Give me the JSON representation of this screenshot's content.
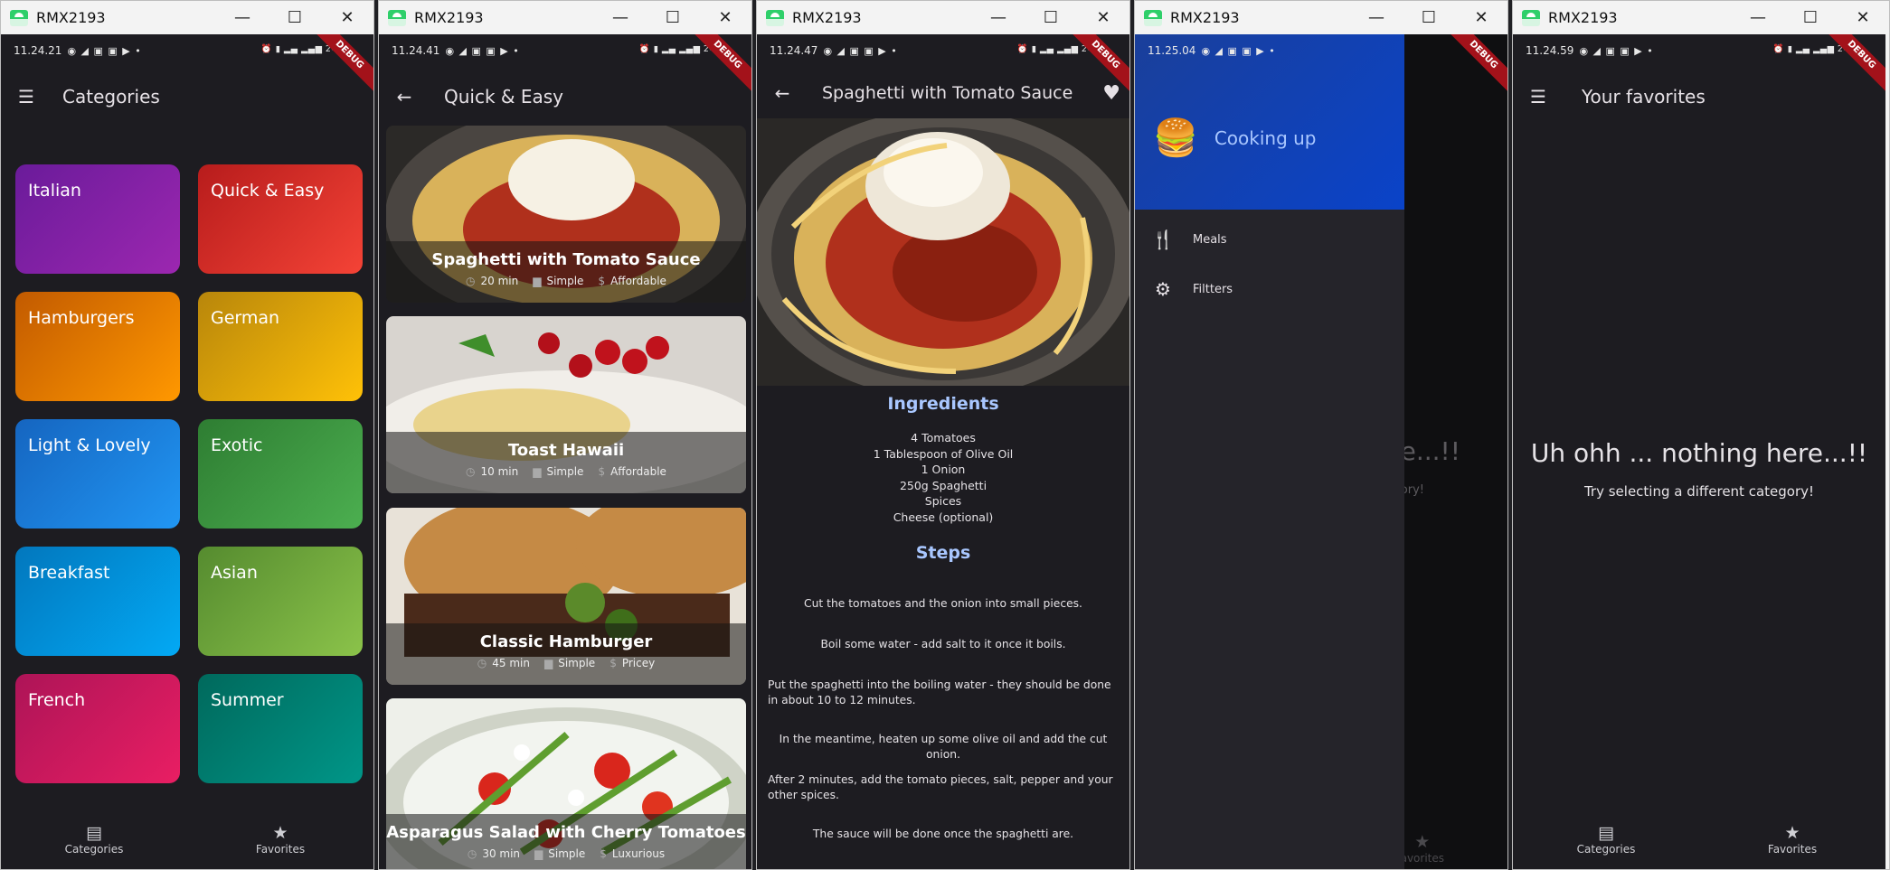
{
  "window_title": "RMX2193",
  "windows": [
    {
      "status_time": "11.24.21"
    },
    {
      "status_time": "11.24.41"
    },
    {
      "status_time": "11.24.47"
    },
    {
      "status_time": "11.25.04"
    },
    {
      "status_time": "11.24.59"
    }
  ],
  "debug_banner": "DEBUG",
  "categories_screen": {
    "title": "Categories",
    "categories": [
      {
        "label": "Italian",
        "color1": "#6a1b9a",
        "color2": "#9c27b0"
      },
      {
        "label": "Quick & Easy",
        "color1": "#b71c1c",
        "color2": "#f44336"
      },
      {
        "label": "Hamburgers",
        "color1": "#c25a00",
        "color2": "#ff9800"
      },
      {
        "label": "German",
        "color1": "#b8860b",
        "color2": "#ffc107"
      },
      {
        "label": "Light & Lovely",
        "color1": "#1565c0",
        "color2": "#2196f3"
      },
      {
        "label": "Exotic",
        "color1": "#2e7d32",
        "color2": "#4caf50"
      },
      {
        "label": "Breakfast",
        "color1": "#0277bd",
        "color2": "#03a9f4"
      },
      {
        "label": "Asian",
        "color1": "#558b2f",
        "color2": "#8bc34a"
      },
      {
        "label": "French",
        "color1": "#ad1457",
        "color2": "#e91e63"
      },
      {
        "label": "Summer",
        "color1": "#00695c",
        "color2": "#009688"
      }
    ]
  },
  "bottom_nav": {
    "categories": "Categories",
    "favorites": "Favorites"
  },
  "meals_screen": {
    "title": "Quick & Easy",
    "meals": [
      {
        "title": "Spaghetti with Tomato Sauce",
        "duration": "20 min",
        "complexity": "Simple",
        "affordability": "Affordable",
        "image": "spaghetti"
      },
      {
        "title": "Toast Hawaii",
        "duration": "10 min",
        "complexity": "Simple",
        "affordability": "Affordable",
        "image": "toast"
      },
      {
        "title": "Classic Hamburger",
        "duration": "45 min",
        "complexity": "Simple",
        "affordability": "Pricey",
        "image": "burger"
      },
      {
        "title": "Asparagus Salad with Cherry Tomatoes",
        "duration": "30 min",
        "complexity": "Simple",
        "affordability": "Luxurious",
        "image": "salad"
      }
    ]
  },
  "detail_screen": {
    "title": "Spaghetti with Tomato Sauce",
    "ingredients_heading": "Ingredients",
    "ingredients": [
      "4 Tomatoes",
      "1 Tablespoon of Olive Oil",
      "1 Onion",
      "250g Spaghetti",
      "Spices",
      "Cheese (optional)"
    ],
    "steps_heading": "Steps",
    "steps": [
      "Cut the tomatoes and the onion into small pieces.",
      "Boil some water - add salt to it once it boils.",
      "Put the spaghetti into the boiling water - they should be done in about 10 to 12 minutes.",
      "In the meantime, heaten up some olive oil and add the cut onion.",
      "After 2 minutes, add the tomato pieces, salt, pepper and your other spices.",
      "The sauce will be done once the spaghetti are."
    ]
  },
  "drawer": {
    "header": "Cooking up",
    "items": [
      "Meals",
      "Filtters"
    ],
    "behind_title": "re...!!",
    "behind_sub": "ory!",
    "behind_fav": "avorites"
  },
  "favorites_screen": {
    "title": "Your favorites",
    "empty_title": "Uh ohh ... nothing here...!!",
    "empty_sub": "Try selecting a different category!"
  }
}
